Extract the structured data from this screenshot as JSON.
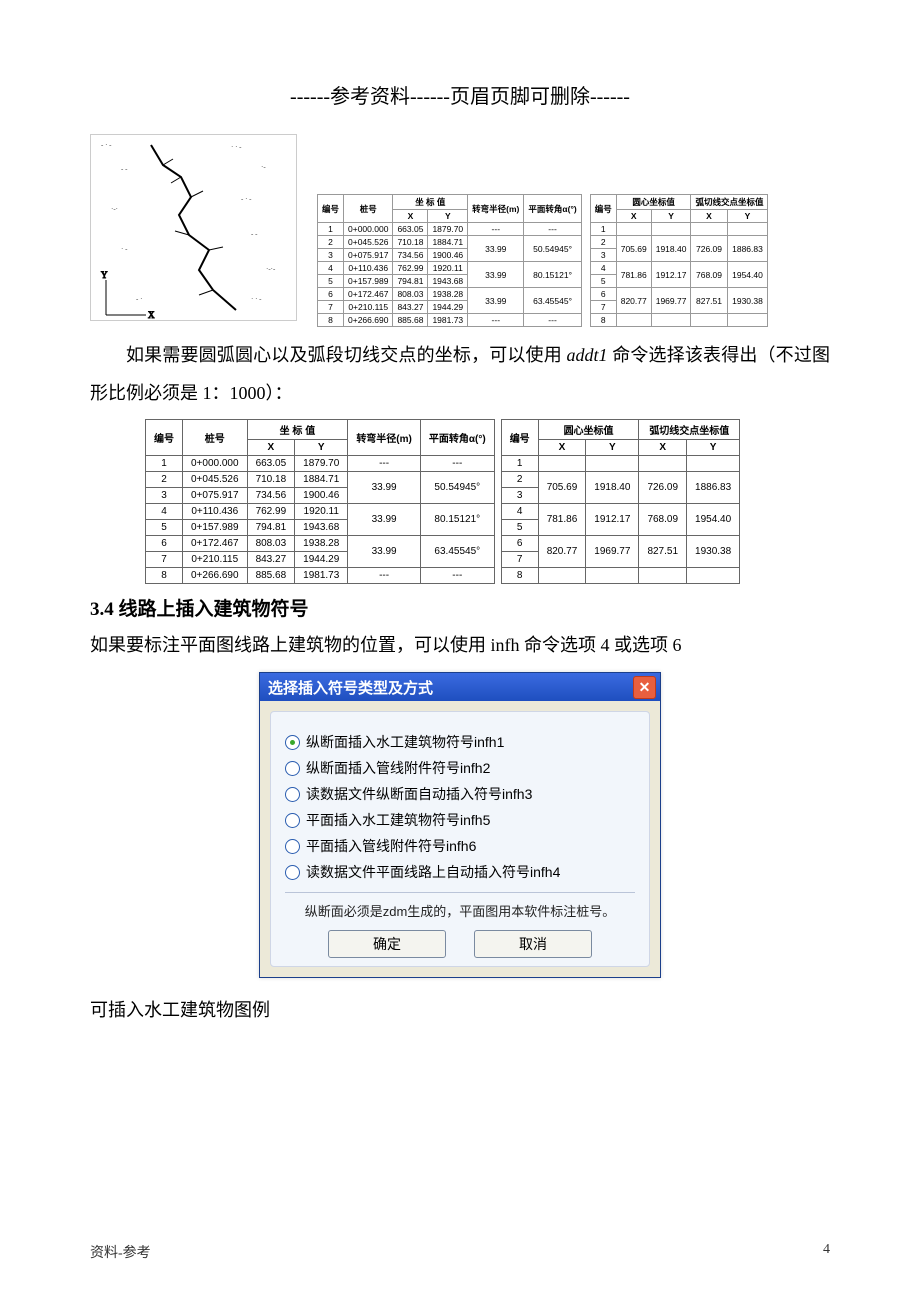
{
  "header_text": "------参考资料------页眉页脚可删除------",
  "paragraph1": {
    "pre": "如果需要圆弧圆心以及弧段切线交点的坐标，可以使用 ",
    "cmd": "addt1",
    "post": " 命令选择该表得出（不过图形比例必须是 1：1000）："
  },
  "section_number": "3.4",
  "section_title": "线路上插入建筑物符号",
  "paragraph2": "如果要标注平面图线路上建筑物的位置，可以使用 infh 命令选项 4 或选项 6",
  "paragraph3": "可插入水工建筑物图例",
  "dialog": {
    "title": "选择插入符号类型及方式",
    "options": [
      {
        "label": "纵断面插入水工建筑物符号infh1",
        "selected": true
      },
      {
        "label": "纵断面插入管线附件符号infh2",
        "selected": false
      },
      {
        "label": "读数据文件纵断面自动插入符号infh3",
        "selected": false
      },
      {
        "label": "平面插入水工建筑物符号infh5",
        "selected": false
      },
      {
        "label": "平面插入管线附件符号infh6",
        "selected": false
      },
      {
        "label": "读数据文件平面线路上自动插入符号infh4",
        "selected": false
      }
    ],
    "hint": "纵断面必须是zdm生成的，平面图用本软件标注桩号。",
    "ok": "确定",
    "cancel": "取消"
  },
  "tableA": {
    "headers": {
      "no": "编号",
      "stake": "桩号",
      "xy": "坐 标 值",
      "x": "X",
      "y": "Y",
      "r": "转弯半径(m)",
      "a": "平面转角α(°)"
    },
    "rows": [
      {
        "no": "1",
        "stake": "0+000.000",
        "x": "663.05",
        "y": "1879.70",
        "r": "---",
        "a": "---"
      },
      {
        "no": "2",
        "stake": "0+045.526",
        "x": "710.18",
        "y": "1884.71",
        "r": "33.99",
        "a": "50.54945°",
        "rs": 2
      },
      {
        "no": "3",
        "stake": "0+075.917",
        "x": "734.56",
        "y": "1900.46"
      },
      {
        "no": "4",
        "stake": "0+110.436",
        "x": "762.99",
        "y": "1920.11",
        "r": "33.99",
        "a": "80.15121°",
        "rs": 2
      },
      {
        "no": "5",
        "stake": "0+157.989",
        "x": "794.81",
        "y": "1943.68"
      },
      {
        "no": "6",
        "stake": "0+172.467",
        "x": "808.03",
        "y": "1938.28",
        "r": "33.99",
        "a": "63.45545°",
        "rs": 2
      },
      {
        "no": "7",
        "stake": "0+210.115",
        "x": "843.27",
        "y": "1944.29"
      },
      {
        "no": "8",
        "stake": "0+266.690",
        "x": "885.68",
        "y": "1981.73",
        "r": "---",
        "a": "---"
      }
    ]
  },
  "tableB": {
    "headers": {
      "no": "编号",
      "c1": "圆心坐标值",
      "c2": "弧切线交点坐标值",
      "x": "X",
      "y": "Y"
    },
    "rows": [
      {
        "no": "1"
      },
      {
        "no": "2",
        "cx": "705.69",
        "cy": "1918.40",
        "tx": "726.09",
        "ty": "1886.83",
        "rs": 2
      },
      {
        "no": "3"
      },
      {
        "no": "4",
        "cx": "781.86",
        "cy": "1912.17",
        "tx": "768.09",
        "ty": "1954.40",
        "rs": 2
      },
      {
        "no": "5"
      },
      {
        "no": "6",
        "cx": "820.77",
        "cy": "1969.77",
        "tx": "827.51",
        "ty": "1930.38",
        "rs": 2
      },
      {
        "no": "7"
      },
      {
        "no": "8"
      }
    ]
  },
  "footer": {
    "left": "资料-参考",
    "page": "4"
  }
}
